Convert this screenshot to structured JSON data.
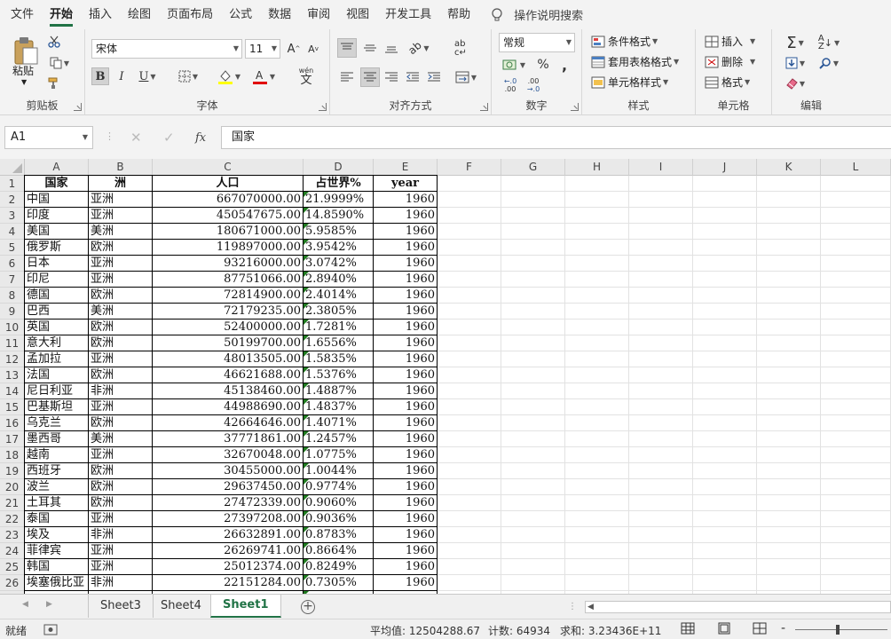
{
  "menu": {
    "tabs": [
      "文件",
      "开始",
      "插入",
      "绘图",
      "页面布局",
      "公式",
      "数据",
      "审阅",
      "视图",
      "开发工具",
      "帮助"
    ],
    "active": "开始",
    "tell_me": "操作说明搜索"
  },
  "ribbon": {
    "clipboard": {
      "label": "剪贴板",
      "paste": "粘贴"
    },
    "font": {
      "label": "字体",
      "name": "宋体",
      "size": "11",
      "bold": "B",
      "italic": "I",
      "underline": "U",
      "wen": "wén"
    },
    "alignment": {
      "label": "对齐方式"
    },
    "number": {
      "label": "数字",
      "format": "常规",
      "percent": "%",
      "comma": ",",
      "inc_decimal": ".00",
      "dec_decimal": ".0"
    },
    "styles": {
      "label": "样式",
      "conditional": "条件格式",
      "table_format": "套用表格格式",
      "cell_styles": "单元格样式"
    },
    "cells": {
      "label": "单元格",
      "insert": "插入",
      "delete": "删除",
      "format": "格式"
    },
    "editing": {
      "label": "编辑"
    }
  },
  "formula_bar": {
    "name_box": "A1",
    "fx": "fx",
    "value": "国家"
  },
  "columns": [
    "A",
    "B",
    "C",
    "D",
    "E",
    "F",
    "G",
    "H",
    "I",
    "J",
    "K",
    "L"
  ],
  "row_numbers": [
    "1",
    "2",
    "3",
    "4",
    "5",
    "6",
    "7",
    "8",
    "9",
    "10",
    "11",
    "12",
    "13",
    "14",
    "15",
    "16",
    "17",
    "18",
    "19",
    "20",
    "21",
    "22",
    "23",
    "24",
    "25",
    "26"
  ],
  "table": {
    "headers": [
      "国家",
      "洲",
      "人口",
      "占世界%",
      "year"
    ],
    "rows": [
      [
        "中国",
        "亚洲",
        "667070000.00",
        "21.9999%",
        "1960"
      ],
      [
        "印度",
        "亚洲",
        "450547675.00",
        "14.8590%",
        "1960"
      ],
      [
        "美国",
        "美洲",
        "180671000.00",
        "5.9585%",
        "1960"
      ],
      [
        "俄罗斯",
        "欧洲",
        "119897000.00",
        "3.9542%",
        "1960"
      ],
      [
        "日本",
        "亚洲",
        "93216000.00",
        "3.0742%",
        "1960"
      ],
      [
        "印尼",
        "亚洲",
        "87751066.00",
        "2.8940%",
        "1960"
      ],
      [
        "德国",
        "欧洲",
        "72814900.00",
        "2.4014%",
        "1960"
      ],
      [
        "巴西",
        "美洲",
        "72179235.00",
        "2.3805%",
        "1960"
      ],
      [
        "英国",
        "欧洲",
        "52400000.00",
        "1.7281%",
        "1960"
      ],
      [
        "意大利",
        "欧洲",
        "50199700.00",
        "1.6556%",
        "1960"
      ],
      [
        "孟加拉",
        "亚洲",
        "48013505.00",
        "1.5835%",
        "1960"
      ],
      [
        "法国",
        "欧洲",
        "46621688.00",
        "1.5376%",
        "1960"
      ],
      [
        "尼日利亚",
        "非洲",
        "45138460.00",
        "1.4887%",
        "1960"
      ],
      [
        "巴基斯坦",
        "亚洲",
        "44988690.00",
        "1.4837%",
        "1960"
      ],
      [
        "乌克兰",
        "欧洲",
        "42664646.00",
        "1.4071%",
        "1960"
      ],
      [
        "墨西哥",
        "美洲",
        "37771861.00",
        "1.2457%",
        "1960"
      ],
      [
        "越南",
        "亚洲",
        "32670048.00",
        "1.0775%",
        "1960"
      ],
      [
        "西班牙",
        "欧洲",
        "30455000.00",
        "1.0044%",
        "1960"
      ],
      [
        "波兰",
        "欧洲",
        "29637450.00",
        "0.9774%",
        "1960"
      ],
      [
        "土耳其",
        "欧洲",
        "27472339.00",
        "0.9060%",
        "1960"
      ],
      [
        "泰国",
        "亚洲",
        "27397208.00",
        "0.9036%",
        "1960"
      ],
      [
        "埃及",
        "非洲",
        "26632891.00",
        "0.8783%",
        "1960"
      ],
      [
        "菲律宾",
        "亚洲",
        "26269741.00",
        "0.8664%",
        "1960"
      ],
      [
        "韩国",
        "亚洲",
        "25012374.00",
        "0.8249%",
        "1960"
      ],
      [
        "埃塞俄比亚",
        "非洲",
        "22151284.00",
        "0.7305%",
        "1960"
      ]
    ]
  },
  "sheets": {
    "tabs": [
      "Sheet3",
      "Sheet4",
      "Sheet1"
    ],
    "active": "Sheet1"
  },
  "status": {
    "ready": "就绪",
    "average": "平均值: 12504288.67",
    "count": "计数: 64934",
    "sum": "求和: 3.23436E+11"
  },
  "colors": {
    "accent": "#217346",
    "error_triangle": "#1f7a1f"
  }
}
